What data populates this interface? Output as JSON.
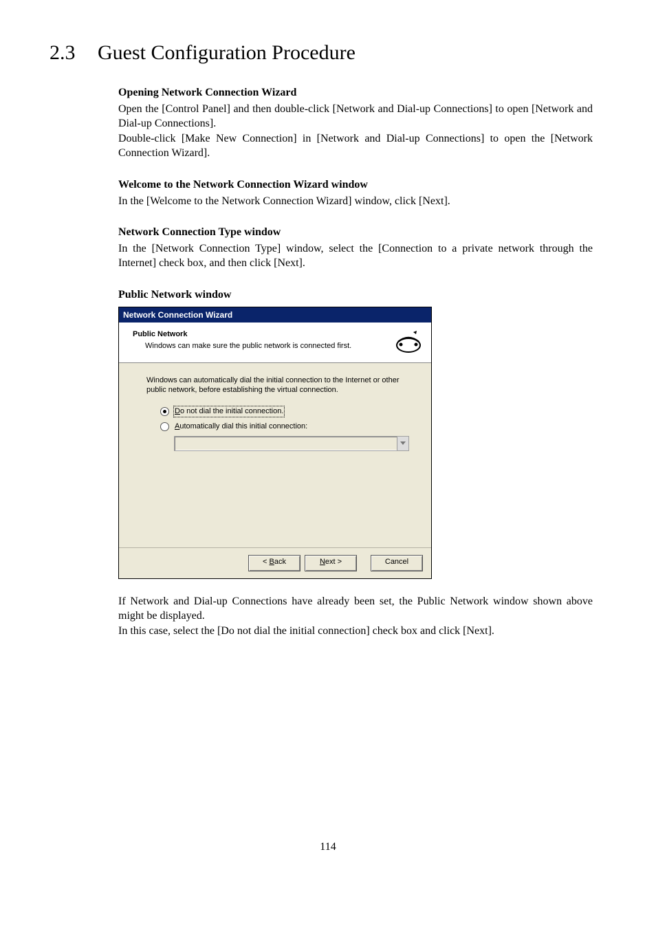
{
  "section": {
    "number": "2.3",
    "title": "Guest Configuration Procedure"
  },
  "sub1": {
    "title": "Opening Network Connection Wizard",
    "p1": "Open the [Control Panel] and then double-click [Network and Dial-up Connections] to open [Network and Dial-up Connections].",
    "p2": "Double-click [Make New Connection] in [Network and Dial-up Connections] to open the [Network Connection Wizard]."
  },
  "sub2": {
    "title": "Welcome to the Network Connection Wizard window",
    "p1": "In the [Welcome to the Network Connection Wizard] window, click [Next]."
  },
  "sub3": {
    "title": "Network Connection Type window",
    "p1": "In the [Network Connection Type] window, select the [Connection to a private network through the Internet] check box, and then click [Next]."
  },
  "sub4": {
    "title": "Public Network window",
    "after1": "If Network and Dial-up Connections have already been set, the Public Network window shown above might be displayed.",
    "after2": "In this case, select the [Do not dial the initial connection] check box and click [Next]."
  },
  "wizard": {
    "titlebar": "Network Connection Wizard",
    "header_title": "Public Network",
    "header_sub": "Windows can make sure the public network is connected first.",
    "instruction": "Windows can automatically dial the initial connection to the Internet or other public network, before establishing the virtual connection.",
    "radio1_pre": "D",
    "radio1_rest": "o not dial the initial connection.",
    "radio2_pre": "A",
    "radio2_rest": "utomatically dial this initial connection:",
    "btn_back_pre": "< ",
    "btn_back_u": "B",
    "btn_back_rest": "ack",
    "btn_next_u": "N",
    "btn_next_rest": "ext >",
    "btn_cancel": "Cancel"
  },
  "page_number": "114"
}
